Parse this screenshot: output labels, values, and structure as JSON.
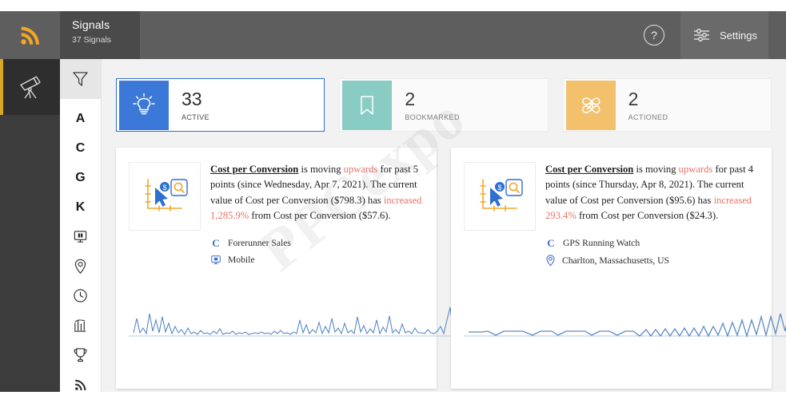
{
  "header": {
    "brand_icon": "rss-signal-icon",
    "title": "Signals",
    "subtitle": "37 Signals",
    "help_label": "?",
    "settings_label": "Settings",
    "settings_icon": "sliders-icon",
    "bg_color": "#5e5e5e",
    "title_bg_color": "#4a4a4a",
    "brand_color": "#f5a623"
  },
  "rail": {
    "items": [
      {
        "icon": "telescope-icon",
        "label": "Explore",
        "active": true,
        "accent": "#d8a723"
      }
    ]
  },
  "iconbar": {
    "filter": {
      "icon": "filter-funnel-icon",
      "label": "Filter"
    },
    "items": [
      {
        "icon": "letter-a-icon",
        "label": "A",
        "type": "letter"
      },
      {
        "icon": "letter-c-icon",
        "label": "C",
        "type": "letter"
      },
      {
        "icon": "letter-g-icon",
        "label": "G",
        "type": "letter"
      },
      {
        "icon": "letter-k-icon",
        "label": "K",
        "type": "letter"
      },
      {
        "icon": "device-screen-icon",
        "label": "Device",
        "type": "glyph"
      },
      {
        "icon": "location-pin-icon",
        "label": "Location",
        "type": "glyph"
      },
      {
        "icon": "clock-icon",
        "label": "Time",
        "type": "glyph"
      },
      {
        "icon": "bar-chart-icon",
        "label": "Performance",
        "type": "glyph"
      },
      {
        "icon": "trophy-icon",
        "label": "Achievements",
        "type": "glyph"
      },
      {
        "icon": "rss-signal-icon",
        "label": "Signals",
        "type": "glyph"
      }
    ]
  },
  "stats": [
    {
      "count": "33",
      "label": "Active",
      "icon": "lightbulb-icon",
      "color": "#3c78d8",
      "selected": true
    },
    {
      "count": "2",
      "label": "Bookmarked",
      "icon": "bookmark-icon",
      "color": "#89ccc4",
      "selected": false
    },
    {
      "count": "2",
      "label": "Actioned",
      "icon": "knot-arrows-icon",
      "color": "#f3c06b",
      "selected": false
    }
  ],
  "signals": [
    {
      "thumb_icon": "cursor-chart-search-icon",
      "metric": "Cost per Conversion",
      "text_1": " is moving ",
      "direction": "upwards",
      "text_2": " for past 5 points (since Wednesday, Apr 7, 2021). The current value of Cost per Conversion ($798.3) has ",
      "change_word": "increased",
      "change_pct": "1,285.9%",
      "text_3": " from Cost per Conversion ($57.6).",
      "meta": [
        {
          "icon": "campaign-c-icon",
          "label": "Forerunner Sales"
        },
        {
          "icon": "device-screen-icon",
          "label": "Mobile"
        }
      ]
    },
    {
      "thumb_icon": "cursor-chart-search-icon",
      "metric": "Cost per Conversion",
      "text_1": " is moving ",
      "direction": "upwards",
      "text_2": " for past 4 points (since Thursday, Apr 8, 2021). The current value of Cost per Conversion ($95.6) has ",
      "change_word": "increased",
      "change_pct": "293.4%",
      "text_3": " from Cost per Conversion ($24.3).",
      "meta": [
        {
          "icon": "campaign-c-icon",
          "label": "GPS Running Watch"
        },
        {
          "icon": "location-pin-icon",
          "label": "Charlton, Massachusetts, US"
        }
      ]
    }
  ],
  "watermark": {
    "text": "PPCexpo"
  },
  "colors": {
    "page_bg": "#f2f2f2",
    "card_bg": "#ffffff",
    "highlight": "#e8736a",
    "link_blue": "#3d6fd0",
    "spark_line": "#5b8ac6"
  }
}
